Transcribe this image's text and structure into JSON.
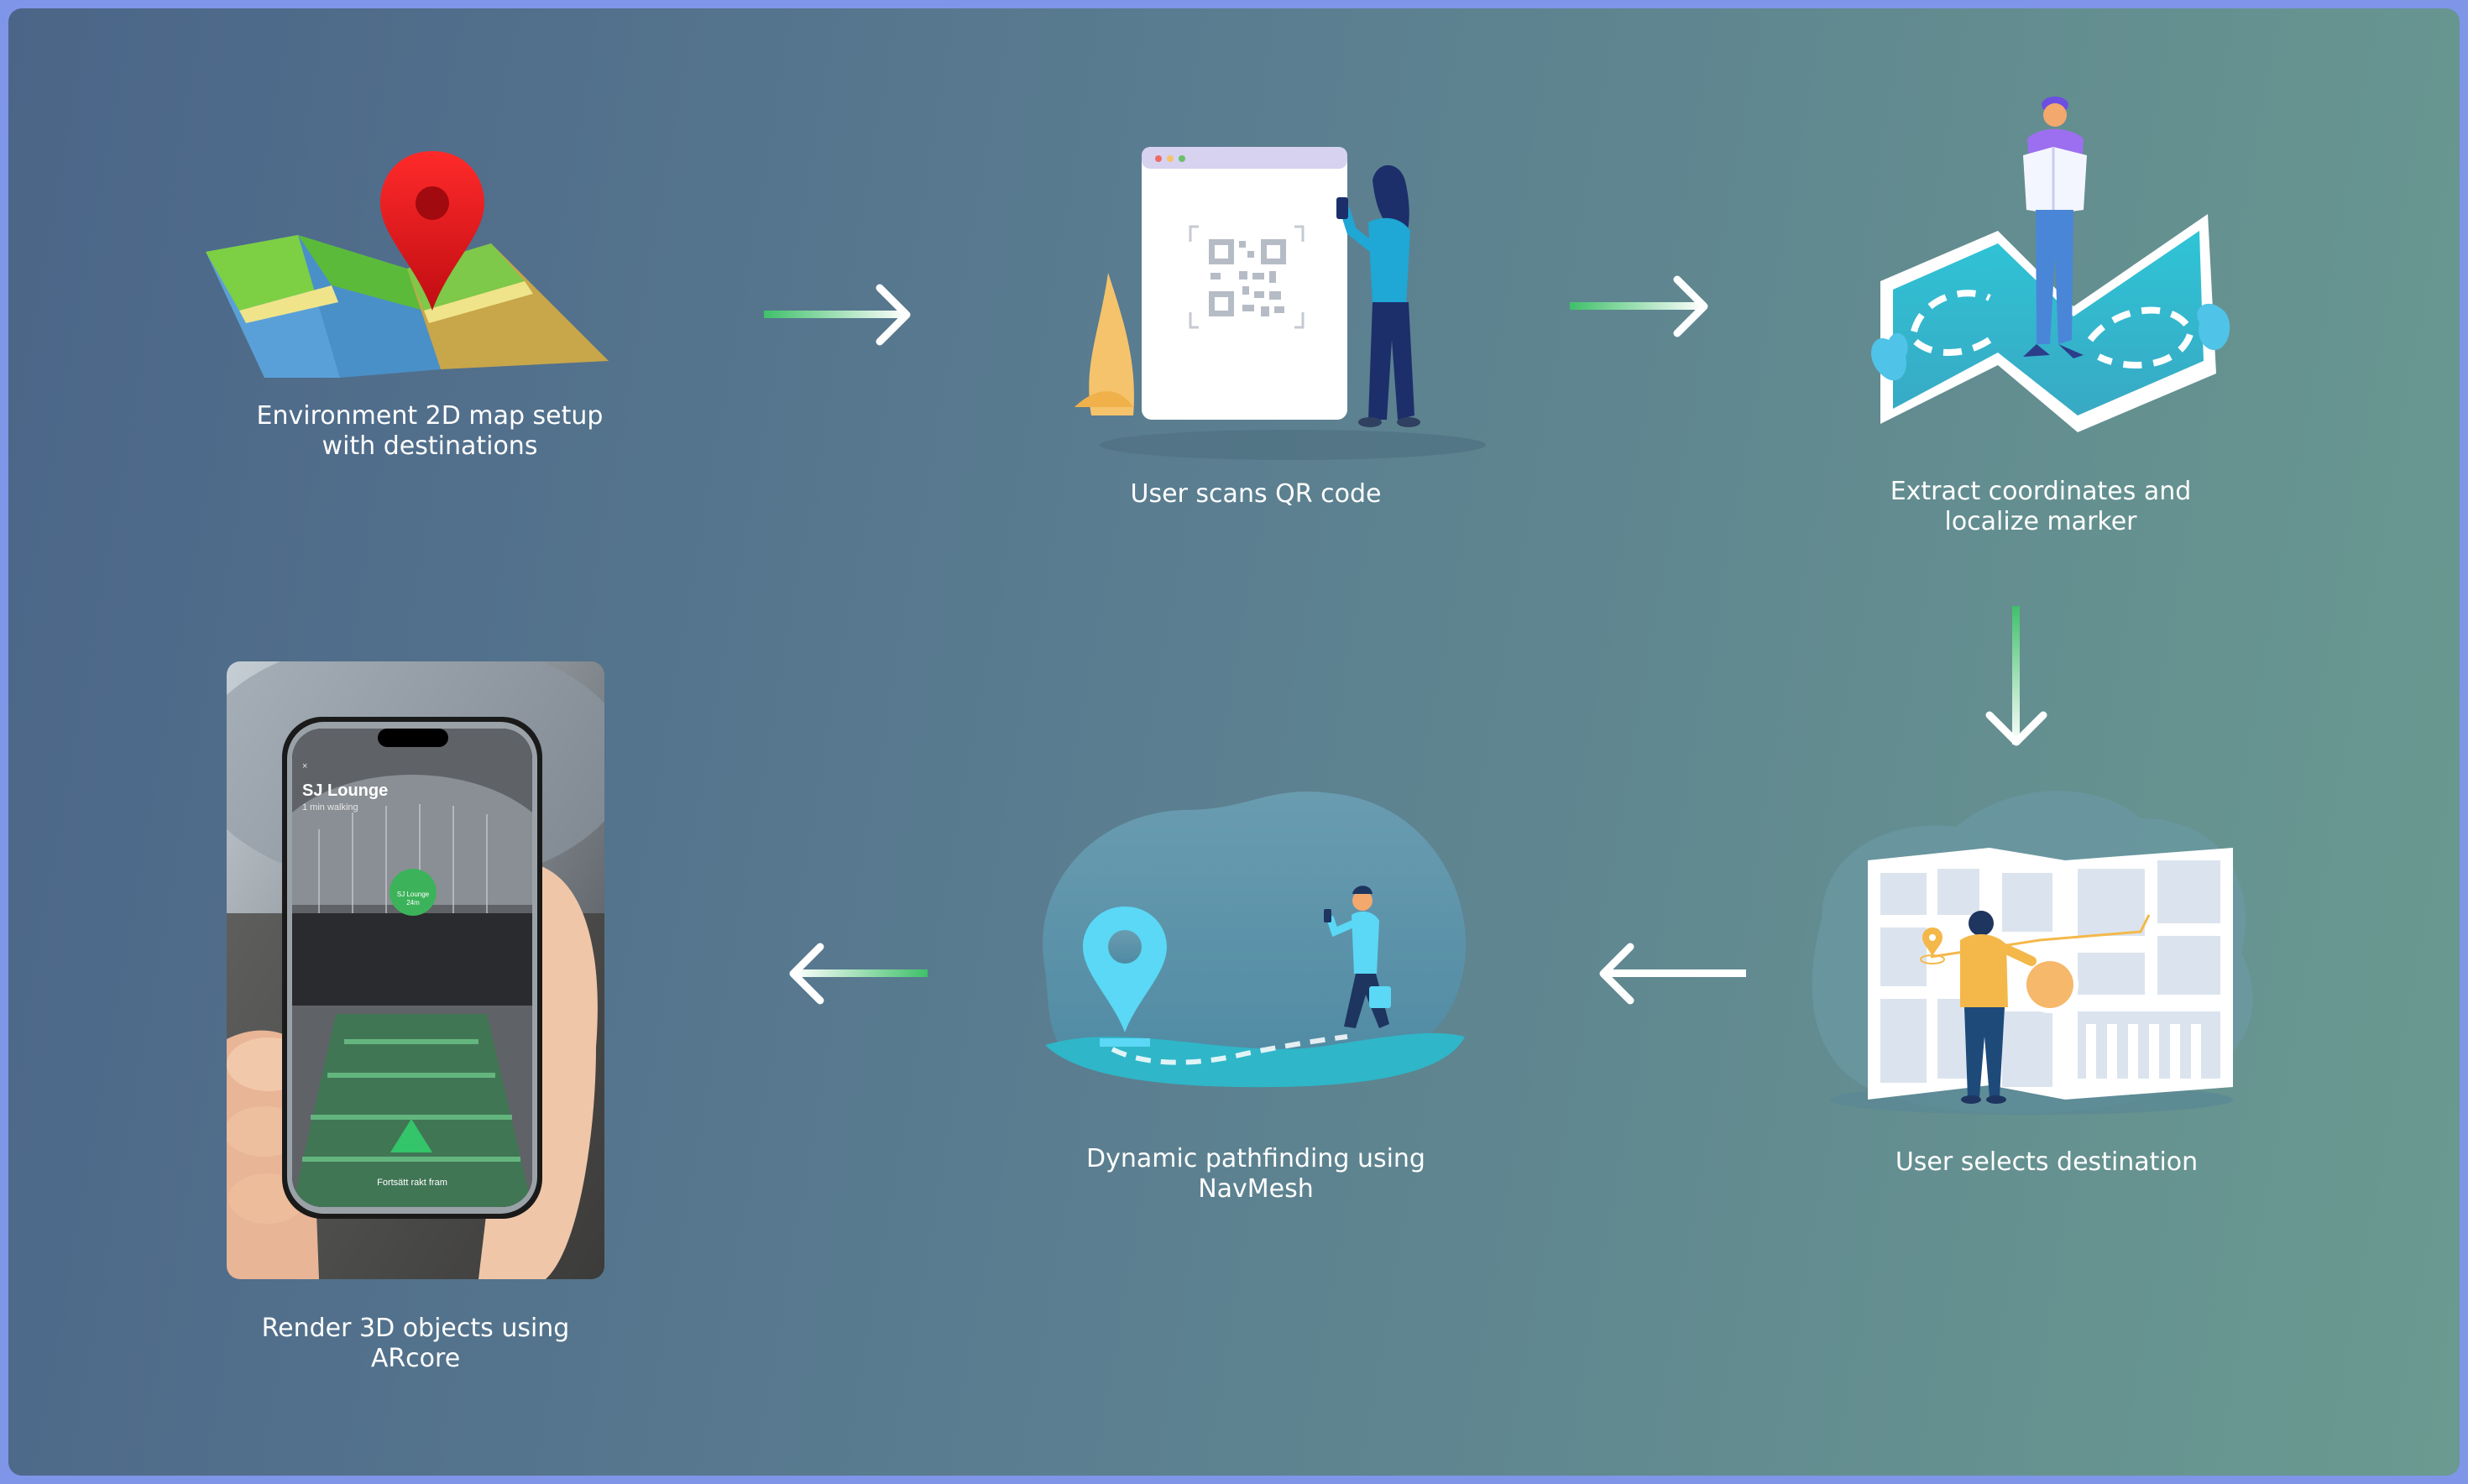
{
  "steps": [
    {
      "id": "map-setup",
      "caption": "Environment 2D map setup\nwith destinations"
    },
    {
      "id": "scan-qr",
      "caption": "User scans QR code"
    },
    {
      "id": "extract",
      "caption": "Extract coordinates and\nlocalize marker"
    },
    {
      "id": "select-dest",
      "caption": "User selects destination"
    },
    {
      "id": "pathfinding",
      "caption": "Dynamic pathfinding using\nNavMesh"
    },
    {
      "id": "render",
      "caption": "Render 3D objects using\nARcore"
    }
  ],
  "phone_screen": {
    "title": "SJ Lounge",
    "subtitle": "1 min walking",
    "badge_name": "SJ Lounge",
    "badge_distance": "24m",
    "footer": "Fortsätt rakt fram",
    "close_icon": "×"
  },
  "icons": [
    "map-pin-icon",
    "qr-code-icon",
    "arrow-right-icon",
    "arrow-down-icon",
    "arrow-left-icon",
    "location-pin-icon",
    "smartphone-icon"
  ],
  "colors": {
    "background_start": "#4b6588",
    "background_end": "#6a9a90",
    "frame": "#7f95e8",
    "arrow_gradient_start": "#3fc06a",
    "arrow_gradient_end": "#ffffff",
    "pin_red": "#e3131b",
    "pin_cyan": "#5ad8f5",
    "person_yellow": "#f4b84a"
  }
}
